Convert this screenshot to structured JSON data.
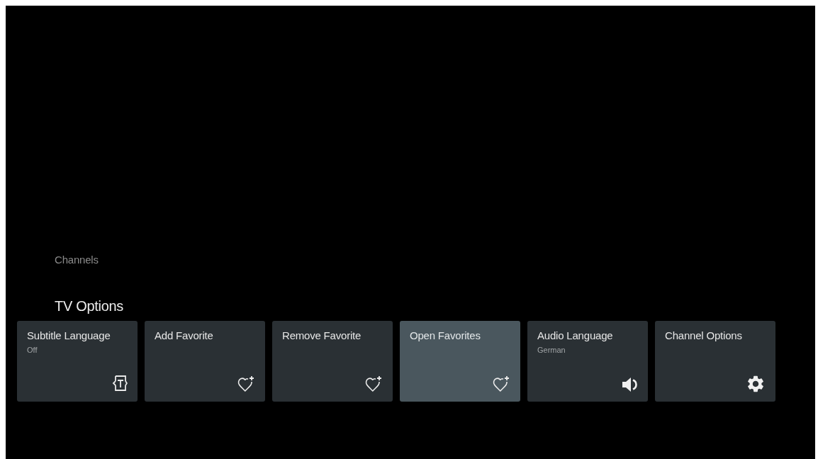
{
  "section_label": "Channels",
  "title": "TV Options",
  "options": [
    {
      "label": "Subtitle Language",
      "value": "Off",
      "kind": "subtitles",
      "selected": false
    },
    {
      "label": "Add Favorite",
      "kind": "favorite",
      "selected": false
    },
    {
      "label": "Remove Favorite",
      "kind": "favorite",
      "selected": false
    },
    {
      "label": "Open Favorites",
      "kind": "favorite",
      "selected": true
    },
    {
      "label": "Audio Language",
      "value": "German",
      "kind": "audio",
      "selected": false
    },
    {
      "label": "Channel Options",
      "kind": "settings",
      "selected": false
    }
  ]
}
